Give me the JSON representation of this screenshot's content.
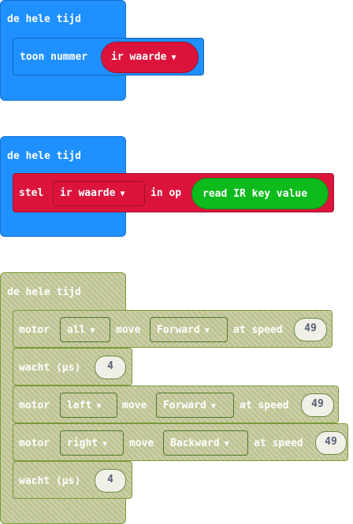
{
  "colors": {
    "event_blue": "#1e90ff",
    "variable_red": "#dc143c",
    "sensor_green": "#0ebb1c",
    "disabled_olive": "#c5c48f"
  },
  "stack1": {
    "hat_label": "de hele tijd",
    "block_label": "toon nummer",
    "variable": "ir waarde"
  },
  "stack2": {
    "hat_label": "de hele tijd",
    "set_label": "stel",
    "variable": "ir waarde",
    "to_label": "in op",
    "value_label": "read IR key value"
  },
  "stack3": {
    "hat_label": "de hele tijd",
    "blocks": [
      {
        "motor_label": "motor",
        "motor": "all",
        "move_label": "move",
        "direction": "Forward",
        "speed_label": "at speed",
        "speed": "49"
      },
      {
        "wait_label": "wacht (µs)",
        "value": "4"
      },
      {
        "motor_label": "motor",
        "motor": "left",
        "move_label": "move",
        "direction": "Forward",
        "speed_label": "at speed",
        "speed": "49"
      },
      {
        "motor_label": "motor",
        "motor": "right",
        "move_label": "move",
        "direction": "Backward",
        "speed_label": "at speed",
        "speed": "49"
      },
      {
        "wait_label": "wacht (µs)",
        "value": "4"
      }
    ]
  }
}
